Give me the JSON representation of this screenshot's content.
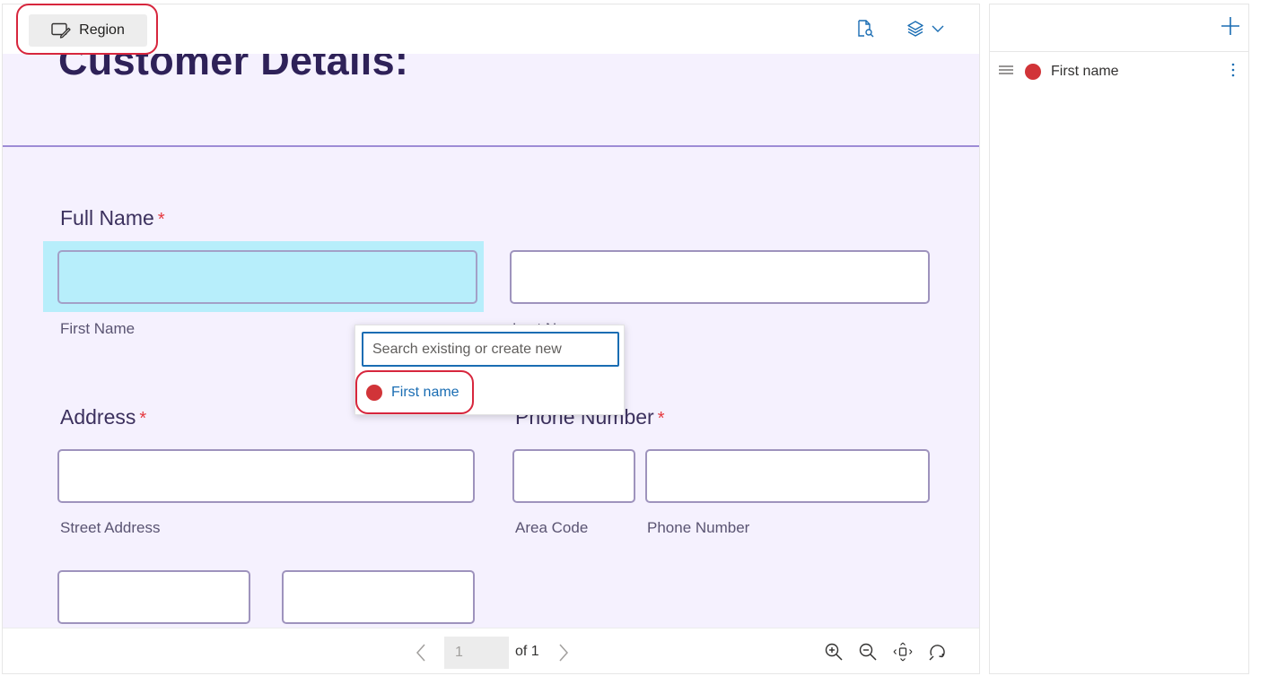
{
  "toolbar": {
    "region_label": "Region"
  },
  "document": {
    "title": "Customer Details:",
    "fields": {
      "full_name_label": "Full Name",
      "required_mark": "*",
      "first_name_sub": "First Name",
      "last_name_sub": "Last Name",
      "address_label": "Address",
      "phone_label": "Phone Number",
      "street_sub": "Street Address",
      "area_code_sub": "Area Code",
      "phone_number_sub": "Phone Number"
    }
  },
  "popup": {
    "search_placeholder": "Search existing or create new",
    "search_value": "",
    "items": [
      {
        "label": "First name",
        "color": "#d13438"
      }
    ]
  },
  "pager": {
    "current_page": "1",
    "of_label": "of 1"
  },
  "side_panel": {
    "items": [
      {
        "label": "First name",
        "color": "#d13438"
      }
    ]
  },
  "icons": {
    "region": "region-edit-icon",
    "doc_search": "document-search-icon",
    "layers": "layers-icon",
    "chevron": "chevron-down-icon",
    "add": "plus-icon",
    "drag": "drag-handle-icon",
    "more": "more-vertical-icon",
    "prev": "chevron-left-icon",
    "next": "chevron-right-icon",
    "zoom_in": "zoom-in-icon",
    "zoom_out": "zoom-out-icon",
    "fit": "fit-page-icon",
    "rotate": "rotate-icon"
  },
  "colors": {
    "accent": "#1a6db3",
    "highlight": "#d7263d",
    "tag_red": "#d13438",
    "selected_field": "#b7eefb",
    "doc_background": "#f5f1fe"
  }
}
